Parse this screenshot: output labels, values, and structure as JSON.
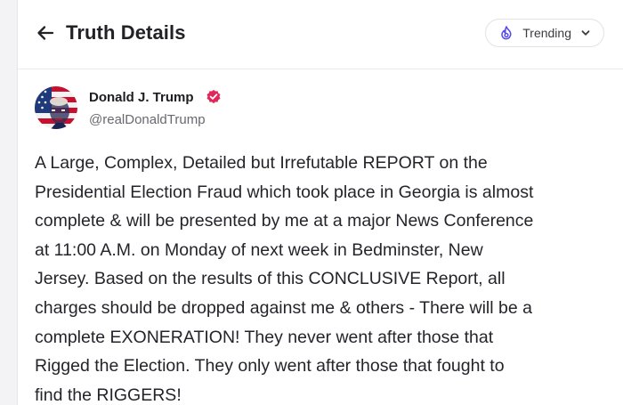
{
  "header": {
    "title": "Truth Details",
    "trending_label": "Trending",
    "back_icon": "arrow-left-icon",
    "trending_icon": "trending-flame-icon",
    "chevron_icon": "chevron-down-icon"
  },
  "post": {
    "author_name": "Donald J. Trump",
    "author_handle": "@realDonaldTrump",
    "verified_icon": "verified-badge-icon",
    "lines": [
      "A Large, Complex, Detailed but Irrefutable REPORT on the",
      "Presidential Election Fraud which took place in Georgia is almost",
      "complete & will be presented by me at a major News Conference",
      "at 11:00 A.M. on Monday of next week in Bedminster, New",
      "Jersey. Based on the results of this CONCLUSIVE Report, all",
      "charges should be dropped against me & others - There will be a",
      "complete EXONERATION! They never went after those that",
      "Rigged the Election. They only went after those that fought to",
      "find the RIGGERS!"
    ]
  },
  "colors": {
    "accent": "#5448ee",
    "verified": "#e0285a",
    "text": "#25242a",
    "muted": "#696870"
  }
}
